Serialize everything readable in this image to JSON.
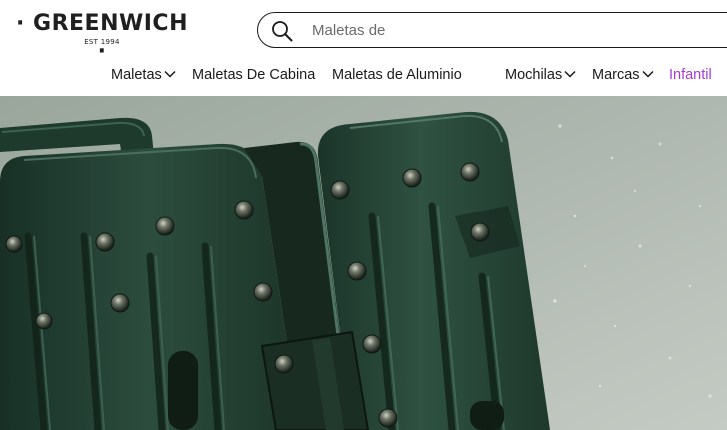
{
  "brand": {
    "name": "GREENWICH",
    "tagline": "EST 1994"
  },
  "search": {
    "placeholder": "Maletas de",
    "value": "",
    "icon": "search-icon"
  },
  "nav": {
    "items": [
      {
        "label": "Maletas",
        "has_dropdown": true
      },
      {
        "label": "Maletas De Cabina",
        "has_dropdown": false
      },
      {
        "label": "Maletas de Aluminio",
        "has_dropdown": false
      },
      {
        "label": "Mochilas",
        "has_dropdown": true
      },
      {
        "label": "Marcas",
        "has_dropdown": true
      },
      {
        "label": "Infantil",
        "has_dropdown": false,
        "highlighted": true
      }
    ]
  },
  "hero": {
    "subject": "dark green aluminium suitcase close-up"
  },
  "colors": {
    "text": "#1a1a1a",
    "accent": "#a63ad6",
    "hero_background": "#aab4ab",
    "suitcase": "#1f3b2e"
  }
}
